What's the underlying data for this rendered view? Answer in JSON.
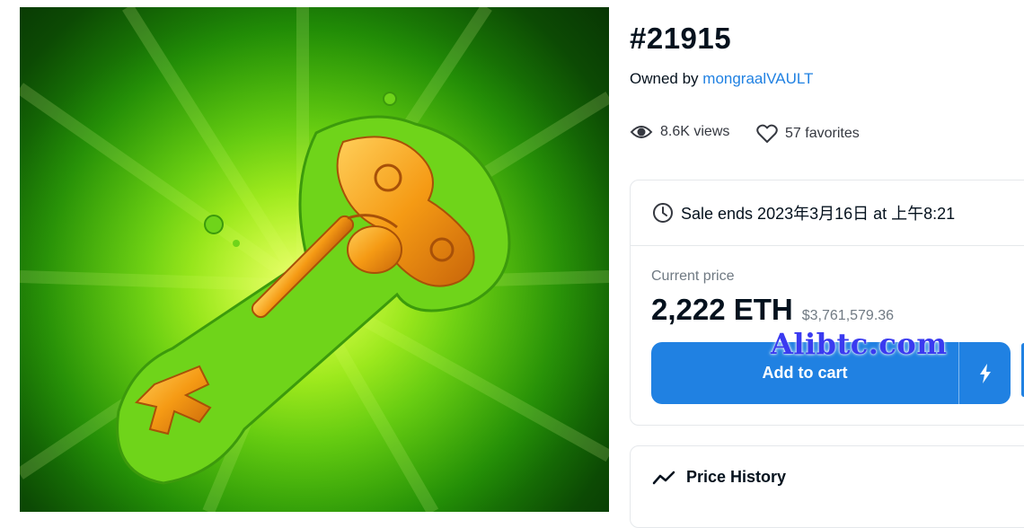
{
  "item": {
    "title": "#21915",
    "owned_by_prefix": "Owned by",
    "owner": "mongraalVAULT",
    "views": "8.6K views",
    "favorites": "57 favorites"
  },
  "sale": {
    "ends_text": "Sale ends 2023年3月16日 at 上午8:21",
    "price_label": "Current price",
    "price_eth": "2,222 ETH",
    "price_usd": "$3,761,579.36",
    "add_to_cart_label": "Add to cart"
  },
  "price_history": {
    "label": "Price History"
  },
  "watermark": "Alibtc.com",
  "icons": {
    "views": "eye-icon",
    "favorites": "heart-icon",
    "sale_ends": "clock-icon",
    "buy_now": "lightning-icon",
    "price_history": "trending-line-icon"
  },
  "colors": {
    "accent": "#2081e2",
    "text": "#04111d",
    "muted": "#707a83",
    "border": "#e5e8eb"
  }
}
